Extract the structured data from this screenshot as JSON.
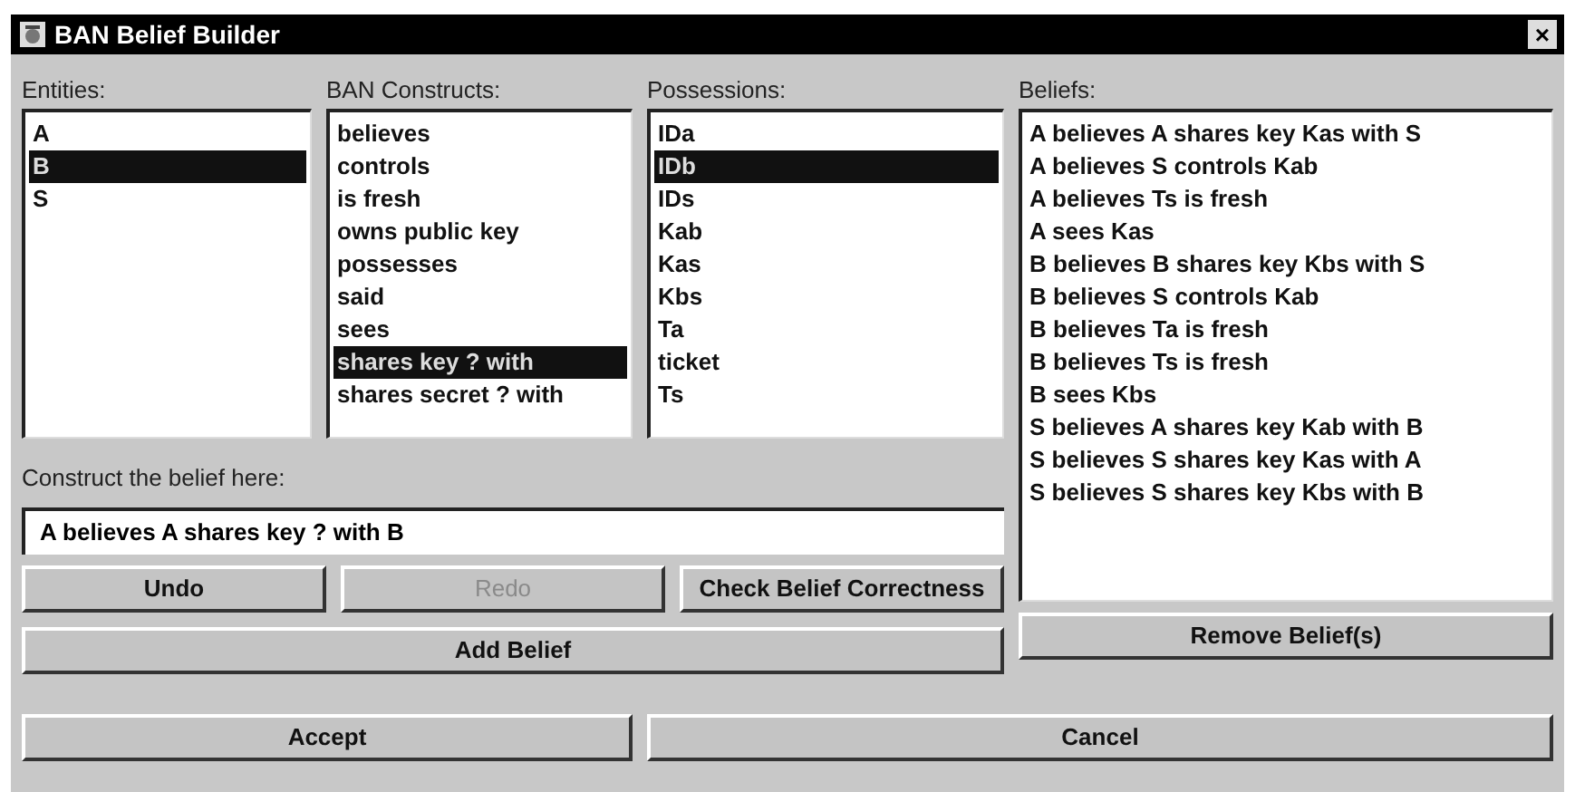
{
  "window": {
    "title": "BAN Belief Builder",
    "close": "×"
  },
  "entities": {
    "label": "Entities:",
    "items": [
      {
        "text": "A",
        "selected": false
      },
      {
        "text": "B",
        "selected": true
      },
      {
        "text": "S",
        "selected": false
      }
    ]
  },
  "constructs": {
    "label": "BAN Constructs:",
    "items": [
      {
        "text": "believes",
        "selected": false
      },
      {
        "text": "controls",
        "selected": false
      },
      {
        "text": "is fresh",
        "selected": false
      },
      {
        "text": "owns public key",
        "selected": false
      },
      {
        "text": "possesses",
        "selected": false
      },
      {
        "text": "said",
        "selected": false
      },
      {
        "text": "sees",
        "selected": false
      },
      {
        "text": "shares key ? with",
        "selected": true
      },
      {
        "text": "shares secret ? with",
        "selected": false
      }
    ]
  },
  "possessions": {
    "label": "Possessions:",
    "items": [
      {
        "text": "IDa",
        "selected": false
      },
      {
        "text": "IDb",
        "selected": true
      },
      {
        "text": "IDs",
        "selected": false
      },
      {
        "text": "Kab",
        "selected": false
      },
      {
        "text": "Kas",
        "selected": false
      },
      {
        "text": "Kbs",
        "selected": false
      },
      {
        "text": "Ta",
        "selected": false
      },
      {
        "text": "ticket",
        "selected": false
      },
      {
        "text": "Ts",
        "selected": false
      }
    ]
  },
  "beliefs": {
    "label": "Beliefs:",
    "items": [
      {
        "text": "A believes A shares key Kas  with S",
        "selected": false
      },
      {
        "text": "A believes S controls Kab",
        "selected": false
      },
      {
        "text": "A believes Ts is fresh",
        "selected": false
      },
      {
        "text": "A sees Kas",
        "selected": false
      },
      {
        "text": "B believes B shares key Kbs with S",
        "selected": false
      },
      {
        "text": "B believes S controls Kab",
        "selected": false
      },
      {
        "text": "B believes Ta is fresh",
        "selected": false
      },
      {
        "text": "B believes Ts is fresh",
        "selected": false
      },
      {
        "text": "B sees Kbs",
        "selected": false
      },
      {
        "text": "S believes A shares key Kab  with B",
        "selected": false
      },
      {
        "text": "S believes S shares key Kas  with A",
        "selected": false
      },
      {
        "text": "S believes S shares key Kbs  with B",
        "selected": false
      }
    ]
  },
  "construct": {
    "label": "Construct the belief here:",
    "value": "A believes A shares key ? with B"
  },
  "edit_buttons": [
    {
      "label": "Undo",
      "disabled": false
    },
    {
      "label": "Redo",
      "disabled": true
    },
    {
      "label": "Check Belief Correctness",
      "disabled": false
    }
  ],
  "add_button": {
    "label": "Add Belief"
  },
  "remove_button": {
    "label": "Remove Belief(s)"
  },
  "dialog_buttons": [
    {
      "label": "Accept"
    },
    {
      "label": "Cancel"
    }
  ]
}
